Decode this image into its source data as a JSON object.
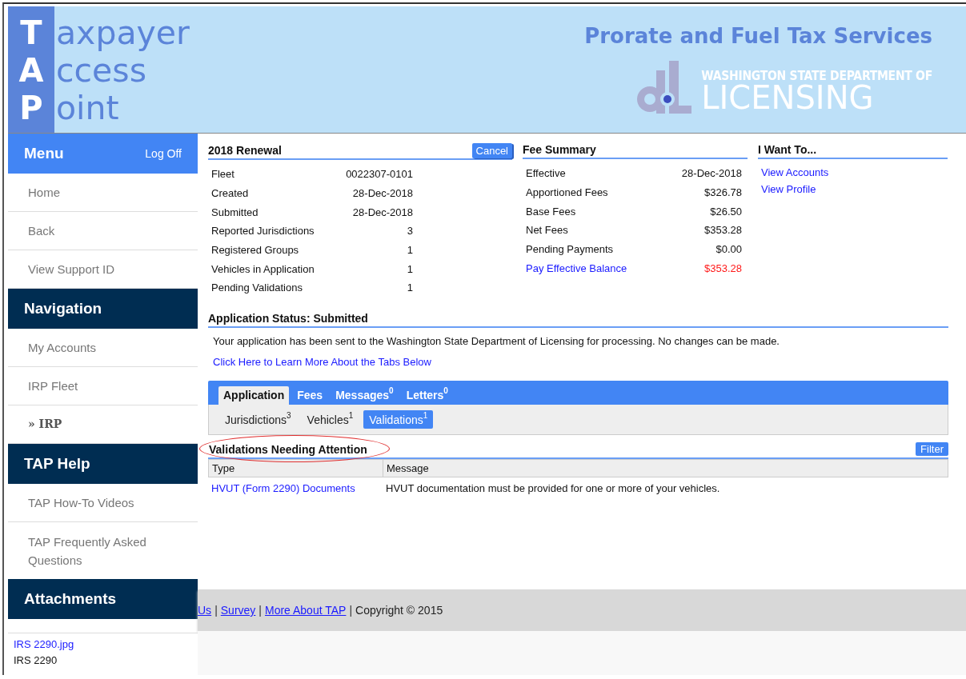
{
  "header": {
    "logo_letters": [
      "T",
      "A",
      "P"
    ],
    "logo_words": [
      "axpayer",
      "ccess",
      "oint"
    ],
    "service_title": "Prorate and Fuel Tax Services",
    "agency_line": "WASHINGTON STATE DEPARTMENT OF",
    "agency_name": "LICENSING"
  },
  "sidebar": {
    "sections": [
      {
        "title": "Menu",
        "kind": "menu",
        "action": "Log Off",
        "items": [
          {
            "label": "Home",
            "current": false
          },
          {
            "label": "Back",
            "current": false
          },
          {
            "label": "View Support ID",
            "current": false
          }
        ]
      },
      {
        "title": "Navigation",
        "kind": "section",
        "items": [
          {
            "label": "My Accounts",
            "current": false
          },
          {
            "label": "IRP Fleet",
            "current": false
          },
          {
            "label": "» IRP",
            "current": true
          }
        ]
      },
      {
        "title": "TAP Help",
        "kind": "section",
        "items": [
          {
            "label": "TAP How-To Videos",
            "current": false
          },
          {
            "label": "TAP Frequently Asked Questions",
            "current": false
          }
        ]
      },
      {
        "title": "Attachments",
        "kind": "attachments",
        "items": [
          {
            "label": "IRS 2290.jpg",
            "kind": "link"
          },
          {
            "label": "IRS 2290",
            "kind": "text"
          }
        ]
      }
    ]
  },
  "renewal": {
    "title": "2018 Renewal",
    "action": "Cancel",
    "rows": [
      {
        "label": "Fleet",
        "value": "0022307-0101"
      },
      {
        "label": "Created",
        "value": "28-Dec-2018"
      },
      {
        "label": "Submitted",
        "value": "28-Dec-2018"
      },
      {
        "label": "Reported Jurisdictions",
        "value": "3"
      },
      {
        "label": "Registered Groups",
        "value": "1"
      },
      {
        "label": "Vehicles in Application",
        "value": "1"
      },
      {
        "label": "Pending Validations",
        "value": "1"
      }
    ]
  },
  "fee_summary": {
    "title": "Fee Summary",
    "rows": [
      {
        "label": "Effective",
        "value": "28-Dec-2018",
        "kind": "plain"
      },
      {
        "label": "Apportioned Fees",
        "value": "$326.78",
        "kind": "plain"
      },
      {
        "label": "Base Fees",
        "value": "$26.50",
        "kind": "plain"
      },
      {
        "label": "Net Fees",
        "value": "$353.28",
        "kind": "plain"
      },
      {
        "label": "Pending Payments",
        "value": "$0.00",
        "kind": "plain"
      },
      {
        "label": "Pay Effective Balance",
        "value": "$353.28",
        "kind": "balance"
      }
    ]
  },
  "i_want_to": {
    "title": "I Want To...",
    "links": [
      "View Accounts",
      "View Profile"
    ]
  },
  "status": {
    "title": "Application Status: Submitted",
    "message": "Your application has been sent to the Washington State Department of Licensing for processing. No changes can be made.",
    "link": "Click Here to Learn More About the Tabs Below"
  },
  "tabs": [
    {
      "label": "Application",
      "selected": true
    },
    {
      "label": "Fees",
      "selected": false
    },
    {
      "label": "Messages",
      "count": "0",
      "selected": false
    },
    {
      "label": "Letters",
      "count": "0",
      "selected": false
    }
  ],
  "subtabs": [
    {
      "label": "Jurisdictions",
      "count": "3",
      "selected": false
    },
    {
      "label": "Vehicles",
      "count": "1",
      "selected": false
    },
    {
      "label": "Validations",
      "count": "1",
      "selected": true
    }
  ],
  "validations": {
    "title": "Validations Needing Attention",
    "circled": true,
    "action": "Filter",
    "columns": [
      "Type",
      "Message"
    ],
    "rows": [
      {
        "type": "HVUT (Form 2290) Documents",
        "message": "HVUT documentation must be provided for one or more of your vehicles."
      }
    ]
  },
  "footer": [
    {
      "text": "Us",
      "kind": "link"
    },
    {
      "text": "|",
      "kind": "separator"
    },
    {
      "text": "Survey",
      "kind": "link"
    },
    {
      "text": "|",
      "kind": "separator"
    },
    {
      "text": "More About TAP",
      "kind": "link"
    },
    {
      "text": "|",
      "kind": "separator"
    },
    {
      "text": "Copyright © 2015",
      "kind": "text"
    }
  ]
}
